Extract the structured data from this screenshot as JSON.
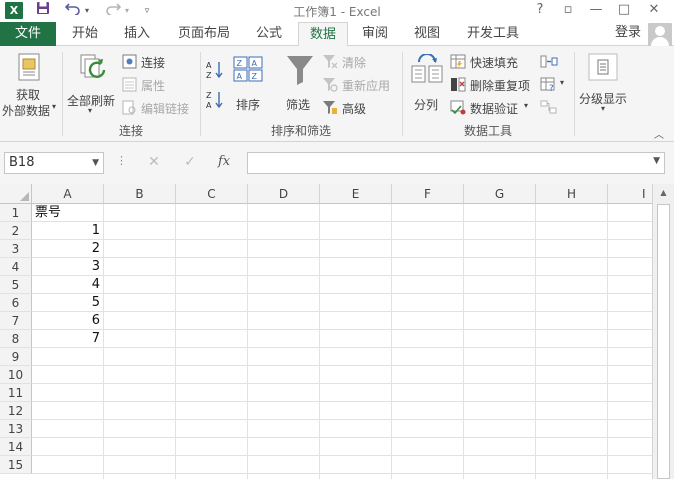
{
  "window": {
    "title": "工作簿1 - Excel",
    "app_logo": "X",
    "help": "?",
    "restore": "▫",
    "minimize": "—",
    "maximize": "□",
    "close": "✕"
  },
  "quick_access": {
    "save": "save-icon",
    "undo": "undo-icon",
    "redo": "redo-icon",
    "customize": "customize-icon"
  },
  "tabs": {
    "file": "文件",
    "items": [
      "开始",
      "插入",
      "页面布局",
      "公式",
      "数据",
      "审阅",
      "视图",
      "开发工具"
    ],
    "active": "数据",
    "login": "登录"
  },
  "ribbon": {
    "get_external_data": [
      "获取",
      "外部数据"
    ],
    "refresh_all": "全部刷新",
    "connections": "连接",
    "properties": "属性",
    "edit_links": "编辑链接",
    "group_connections": "连接",
    "sort_az": "A→Z",
    "sort_za": "Z→A",
    "sort": "排序",
    "filter": "筛选",
    "clear": "清除",
    "reapply": "重新应用",
    "advanced": "高级",
    "group_sort_filter": "排序和筛选",
    "text_to_columns": "分列",
    "flash_fill": "快速填充",
    "remove_duplicates": "删除重复项",
    "data_validation": "数据验证",
    "group_data_tools": "数据工具",
    "outline": "分级显示"
  },
  "formula_bar": {
    "name_box": "B18",
    "cancel": "✕",
    "enter": "✓",
    "fx": "fx",
    "value": ""
  },
  "sheet": {
    "columns": [
      "A",
      "B",
      "C",
      "D",
      "E",
      "F",
      "G",
      "H",
      "I"
    ],
    "rows": [
      "1",
      "2",
      "3",
      "4",
      "5",
      "6",
      "7",
      "8",
      "9",
      "10",
      "11",
      "12",
      "13",
      "14",
      "15"
    ],
    "header_cell": "票号",
    "values": [
      "1",
      "2",
      "3",
      "4",
      "5",
      "6",
      "7"
    ]
  },
  "colors": {
    "excel_green": "#217346",
    "ribbon_bg": "#f5f5f5",
    "grid_line": "#e2e2e2"
  }
}
